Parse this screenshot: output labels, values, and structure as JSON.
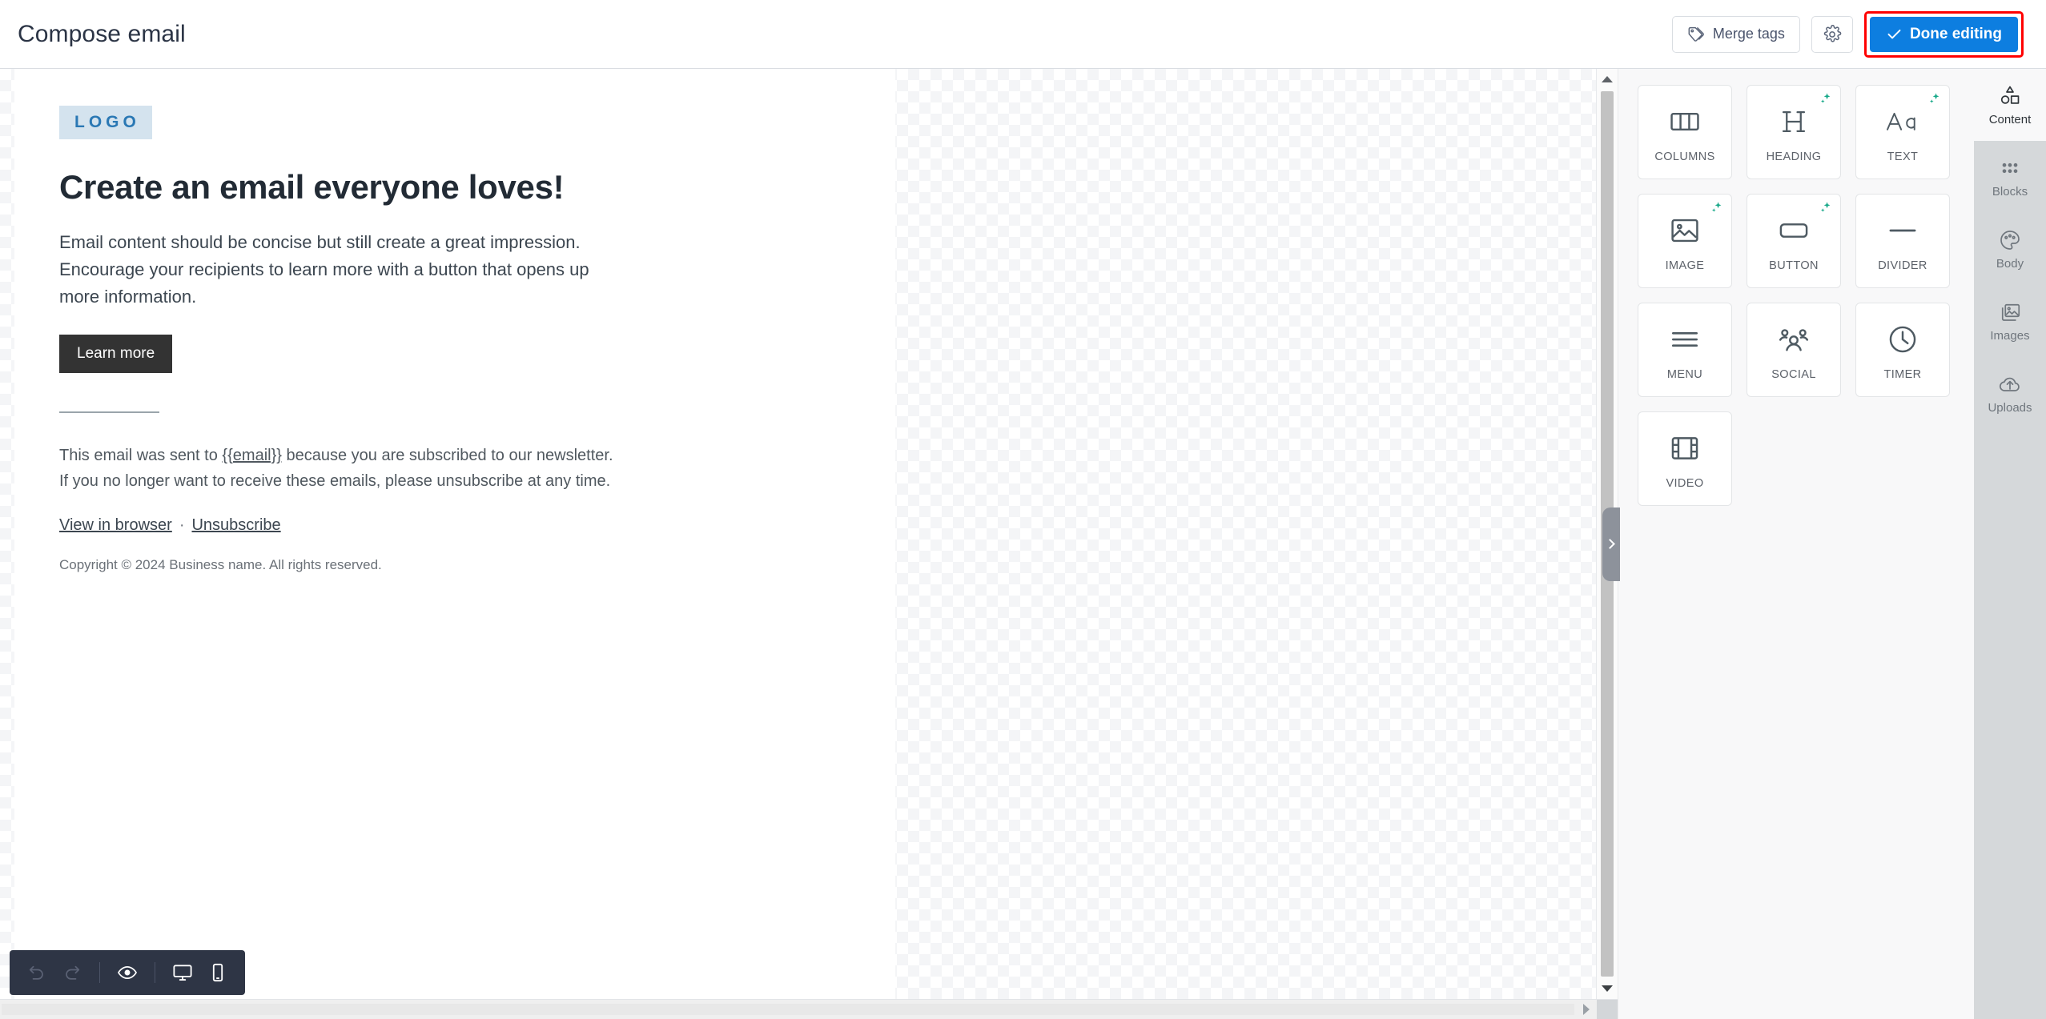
{
  "header": {
    "title": "Compose email",
    "merge_tags_label": "Merge tags",
    "merge_tags_icon": "tag-icon",
    "settings_icon": "gear-icon",
    "done_label": "Done editing",
    "done_icon": "check-icon",
    "done_highlight_color": "#ff0000",
    "primary_color": "#0d7ee0"
  },
  "email": {
    "logo_text": "LOGO",
    "logo_bg": "#d4e3ee",
    "logo_color": "#2a78b4",
    "heading": "Create an email everyone loves!",
    "body": "Email content should be concise but still create a great impression. Encourage your recipients to learn more with a button that opens up more information.",
    "cta_label": "Learn more",
    "cta_bg": "#333333",
    "footer_text_before": "This email was sent to ",
    "footer_merge_tag": "{{email}}",
    "footer_text_after": " because you are subscribed to our newsletter. If you no longer want to receive these emails, please unsubscribe at any time.",
    "link_view": "View in browser",
    "link_separator": "·",
    "link_unsubscribe": "Unsubscribe",
    "copyright": "Copyright © 2024 Business name. All rights reserved."
  },
  "blocks_panel": {
    "tiles": [
      {
        "label": "COLUMNS",
        "icon": "columns-icon",
        "ai": false
      },
      {
        "label": "HEADING",
        "icon": "heading-icon",
        "ai": true
      },
      {
        "label": "TEXT",
        "icon": "text-icon",
        "ai": true
      },
      {
        "label": "IMAGE",
        "icon": "image-icon",
        "ai": true
      },
      {
        "label": "BUTTON",
        "icon": "button-icon",
        "ai": true
      },
      {
        "label": "DIVIDER",
        "icon": "divider-icon",
        "ai": false
      },
      {
        "label": "MENU",
        "icon": "menu-icon",
        "ai": false
      },
      {
        "label": "SOCIAL",
        "icon": "social-icon",
        "ai": false
      },
      {
        "label": "TIMER",
        "icon": "timer-icon",
        "ai": false
      },
      {
        "label": "VIDEO",
        "icon": "video-icon",
        "ai": false
      }
    ],
    "ai_badge_color": "#16a888",
    "collapse_icon": "chevron-right-icon"
  },
  "nav_rail": {
    "items": [
      {
        "label": "Content",
        "icon": "shapes-icon",
        "active": true
      },
      {
        "label": "Blocks",
        "icon": "grid-dots-icon",
        "active": false
      },
      {
        "label": "Body",
        "icon": "palette-icon",
        "active": false
      },
      {
        "label": "Images",
        "icon": "images-icon",
        "active": false
      },
      {
        "label": "Uploads",
        "icon": "cloud-upload-icon",
        "active": false
      }
    ]
  },
  "bottom_toolbar": {
    "undo_icon": "undo-icon",
    "redo_icon": "redo-icon",
    "preview_icon": "eye-icon",
    "desktop_icon": "desktop-icon",
    "mobile_icon": "mobile-icon",
    "background": "#2e3545"
  }
}
